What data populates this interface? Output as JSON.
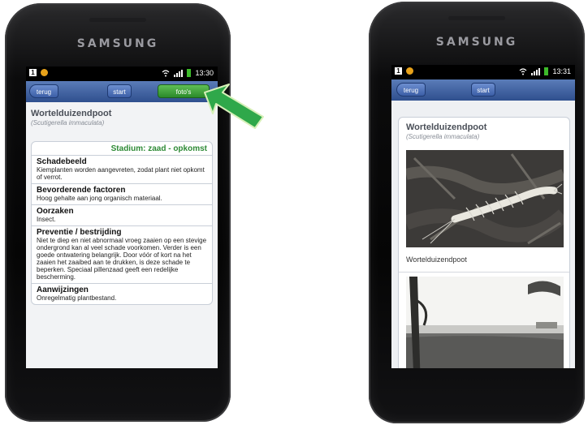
{
  "left_phone": {
    "brand": "SAMSUNG",
    "status": {
      "sim_icon": "sim-icon",
      "notification_icon": "orange-notification-icon",
      "time": "13:30"
    },
    "toolbar": {
      "back": "terug",
      "start": "start",
      "photos": "foto's"
    },
    "header": {
      "title": "Wortelduizendpoot",
      "latin": "(Scutigerella immaculata)"
    },
    "stadium": "Stadium: zaad - opkomst",
    "sections": [
      {
        "title": "Schadebeeld",
        "text": "Kiemplanten worden aangevreten, zodat plant niet opkomt of verrot."
      },
      {
        "title": "Bevorderende factoren",
        "text": "Hoog gehalte aan jong organisch materiaal."
      },
      {
        "title": "Oorzaken",
        "text": "Insect."
      },
      {
        "title": "Preventie / bestrijding",
        "text": "Niet te diep en niet abnormaal vroeg zaaien op een stevige ondergrond kan al veel schade voorkomen. Verder is een goede ontwatering belangrijk. Door vóór of kort na het zaaien het zaaibed aan te drukken, is deze schade te beperken. Speciaal pillenzaad geeft een redelijke bescherming."
      },
      {
        "title": "Aanwijzingen",
        "text": "Onregelmatig plantbestand."
      }
    ]
  },
  "right_phone": {
    "brand": "SAMSUNG",
    "status": {
      "time": "13:31"
    },
    "toolbar": {
      "back": "terug",
      "start": "start"
    },
    "header": {
      "title": "Wortelduizendpoot",
      "latin": "(Scutigerella immaculata)"
    },
    "photo_caption": "Wortelduizendpoot"
  },
  "annotation": {
    "arrow_color": "#2fa84a",
    "icon": "green-arrow-icon"
  }
}
